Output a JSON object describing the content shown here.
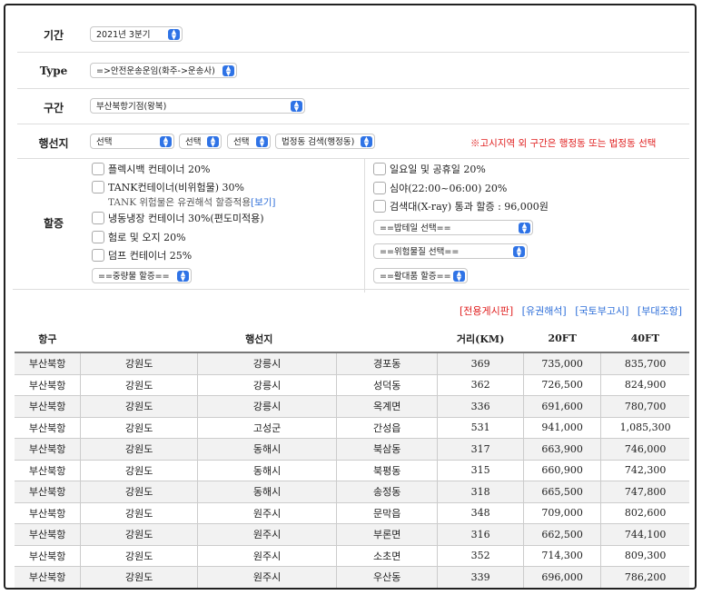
{
  "form": {
    "period": {
      "label": "기간",
      "value": "2021년 3분기"
    },
    "type": {
      "label": "Type",
      "value": "=>안전운송운임(화주->운송사)"
    },
    "section": {
      "label": "구간",
      "value": "부산북항기점(왕복)"
    },
    "route": {
      "label": "행선지",
      "sel1": "선택",
      "sel2": "선택",
      "sel3": "선택",
      "sel4": "법정동 검색(행정동)",
      "notice": "※고시지역 외 구간은 행정동 또는 법정동 선택"
    },
    "surcharge": {
      "label": "할증",
      "left": [
        "플렉시백 컨테이너 20%",
        "TANK컨테이너(비위험물) 30%",
        "냉동냉장 컨테이너 30%(편도미적용)",
        "험로 및 오지 20%",
        "덤프 컨테이너 25%"
      ],
      "tank_note": "TANK 위험물은 유권해석 할증적용",
      "tank_link": "[보기]",
      "weight_select": "==중량물 할증==",
      "right": [
        "일요일 및 공휴일 20%",
        "심야(22:00~06:00) 20%",
        "검색대(X-ray) 통과 할증 : 96,000원"
      ],
      "ex_select": "==밥테일 선택==",
      "danger_select": "==위험물질 선택==",
      "large_select": "==활대품 할증=="
    }
  },
  "links": {
    "board": "[전용게시판]",
    "interp": "[유권해석]",
    "notice": "[국토부고시]",
    "sup": "[부대조항]"
  },
  "colors": {
    "accent": "#2f73e6",
    "red": "#e02020",
    "link": "#2f6fd9"
  },
  "table": {
    "headers": {
      "port": "항구",
      "dest": "행선지",
      "dist": "거리(KM)",
      "ft20": "20FT",
      "ft40": "40FT"
    },
    "rows": [
      [
        "부산북항",
        "강원도",
        "강릉시",
        "경포동",
        "369",
        "735,000",
        "835,700"
      ],
      [
        "부산북항",
        "강원도",
        "강릉시",
        "성덕동",
        "362",
        "726,500",
        "824,900"
      ],
      [
        "부산북항",
        "강원도",
        "강릉시",
        "옥계면",
        "336",
        "691,600",
        "780,700"
      ],
      [
        "부산북항",
        "강원도",
        "고성군",
        "간성읍",
        "531",
        "941,000",
        "1,085,300"
      ],
      [
        "부산북항",
        "강원도",
        "동해시",
        "북삼동",
        "317",
        "663,900",
        "746,000"
      ],
      [
        "부산북항",
        "강원도",
        "동해시",
        "북평동",
        "315",
        "660,900",
        "742,300"
      ],
      [
        "부산북항",
        "강원도",
        "동해시",
        "송정동",
        "318",
        "665,500",
        "747,800"
      ],
      [
        "부산북항",
        "강원도",
        "원주시",
        "문막읍",
        "348",
        "709,000",
        "802,600"
      ],
      [
        "부산북항",
        "강원도",
        "원주시",
        "부론면",
        "316",
        "662,500",
        "744,100"
      ],
      [
        "부산북항",
        "강원도",
        "원주시",
        "소초면",
        "352",
        "714,300",
        "809,300"
      ],
      [
        "부산북항",
        "강원도",
        "원주시",
        "우산동",
        "339",
        "696,000",
        "786,200"
      ]
    ]
  }
}
